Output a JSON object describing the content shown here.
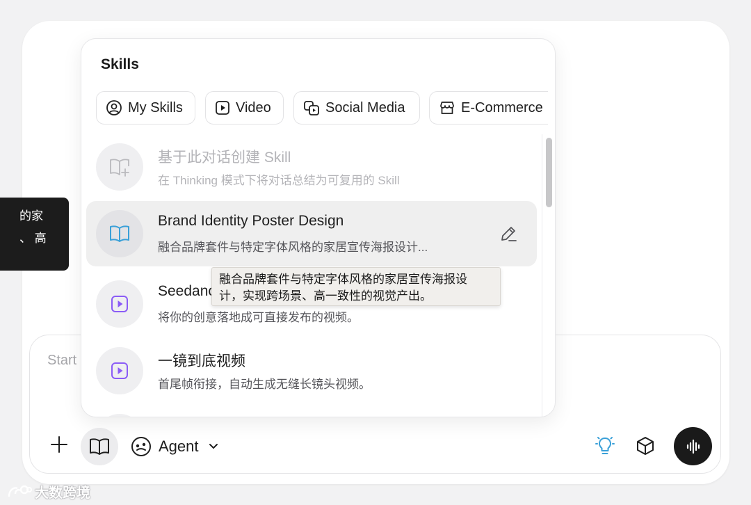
{
  "side_tooltip": {
    "line1": "的家",
    "line2": "、 高"
  },
  "composer": {
    "placeholder": "Start",
    "agent_label": "Agent"
  },
  "skills": {
    "title": "Skills",
    "chips": [
      {
        "label": "My Skills",
        "icon": "user-circle-icon"
      },
      {
        "label": "Video",
        "icon": "play-square-icon"
      },
      {
        "label": "Social Media",
        "icon": "social-media-icon"
      },
      {
        "label": "E-Commerce",
        "icon": "storefront-icon"
      }
    ],
    "items": [
      {
        "name": "基于此对话创建 Skill",
        "desc": "在 Thinking 模式下将对话总结为可复用的 Skill",
        "icon": "create-skill-icon"
      },
      {
        "name": "Brand Identity Poster Design",
        "desc": "融合品牌套件与特定字体风格的家居宣传海报设计...",
        "icon": "book-icon"
      },
      {
        "name": "Seedance",
        "desc": "将你的创意落地成可直接发布的视频。",
        "icon": "play-square-icon"
      },
      {
        "name": "一镜到底视频",
        "desc": "首尾帧衔接，自动生成无缝长镜头视频。",
        "icon": "play-square-icon"
      }
    ]
  },
  "tooltip": {
    "line1": "融合品牌套件与特定字体风格的家居宣传海报设",
    "line2": "计，实现跨场景、高一致性的视觉产出。"
  },
  "watermark": "大数跨境",
  "colors": {
    "accent_purple": "#8b5cf6",
    "accent_blue": "#3aa0d8",
    "dark_button": "#1a1a1a"
  }
}
